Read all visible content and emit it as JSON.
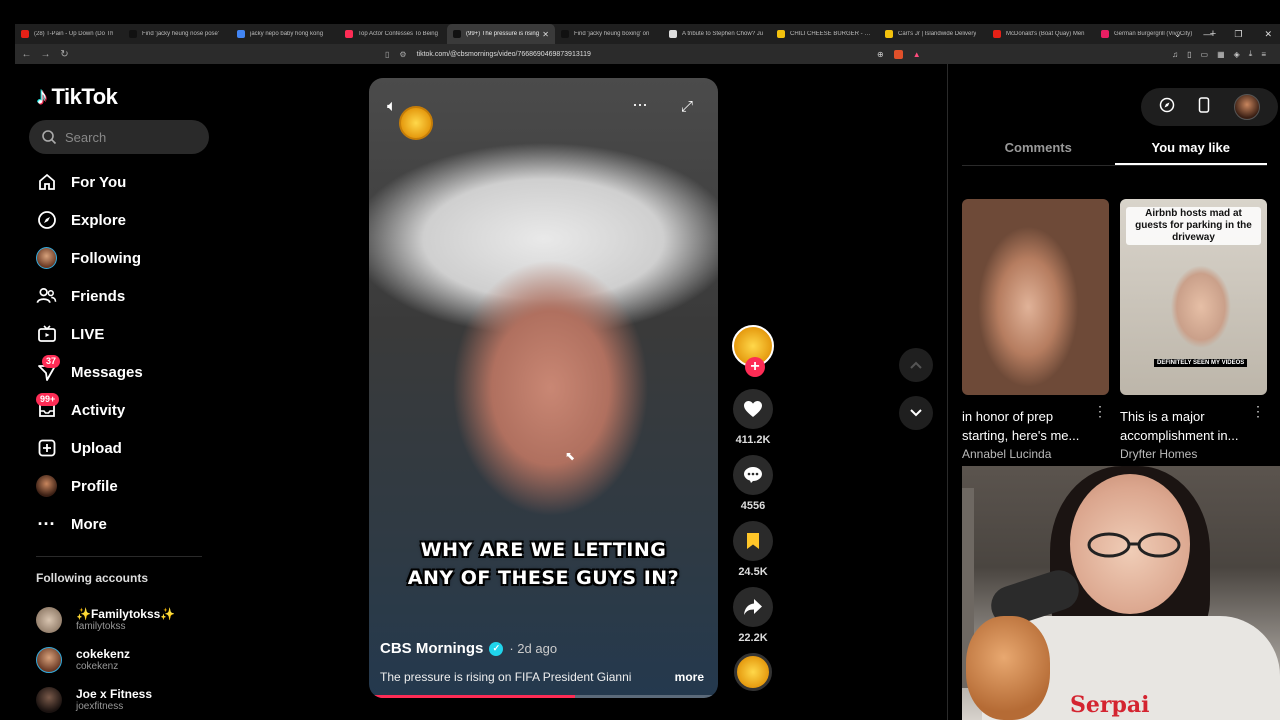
{
  "browser": {
    "tabs": [
      {
        "title": "(28) T-Pain - Up Down (Do Th",
        "color": "#e62117",
        "active": false
      },
      {
        "title": "Find 'jacky heung nose pose'",
        "color": "#111111",
        "active": false
      },
      {
        "title": "jacky nepo baby hong kong",
        "color": "#4285f4",
        "active": false
      },
      {
        "title": "Top Actor Confesses To Being",
        "color": "#fe2c55",
        "active": false
      },
      {
        "title": "(99+) The pressure is rising",
        "color": "#111111",
        "active": true
      },
      {
        "title": "Find 'jacky heung boxing' on",
        "color": "#111111",
        "active": false
      },
      {
        "title": "A tribute to Stephen Chow? Ju",
        "color": "#dddddd",
        "active": false
      },
      {
        "title": "CHILI CHEESE BURGER - Carl's",
        "color": "#f4c20d",
        "active": false
      },
      {
        "title": "Carl's Jr | Islandwide Delivery",
        "color": "#f4c20d",
        "active": false
      },
      {
        "title": "McDonald's (Boat Quay) Men",
        "color": "#e62117",
        "active": false
      },
      {
        "title": "German Burgergrill (VivoCity)",
        "color": "#e91e63",
        "active": false
      }
    ],
    "url": "tiktok.com/@cbsmornings/video/7668690469873913119"
  },
  "sidebar": {
    "brand": "TikTok",
    "search_placeholder": "Search",
    "nav": [
      {
        "label": "For You",
        "icon": "home-icon"
      },
      {
        "label": "Explore",
        "icon": "compass-icon"
      },
      {
        "label": "Following",
        "icon": "avatar"
      },
      {
        "label": "Friends",
        "icon": "friends-icon"
      },
      {
        "label": "LIVE",
        "icon": "live-icon"
      },
      {
        "label": "Messages",
        "icon": "paper-plane-icon",
        "badge": "37"
      },
      {
        "label": "Activity",
        "icon": "inbox-icon",
        "badge": "99+"
      },
      {
        "label": "Upload",
        "icon": "plus-square-icon"
      },
      {
        "label": "Profile",
        "icon": "avatar"
      },
      {
        "label": "More",
        "icon": "ellipsis-icon"
      }
    ],
    "following_title": "Following accounts",
    "following": [
      {
        "name": "✨Familytokss✨",
        "handle": "familytokss"
      },
      {
        "name": "cokekenz",
        "handle": "cokekenz"
      },
      {
        "name": "Joe x Fitness",
        "handle": "joexfitness"
      }
    ]
  },
  "video": {
    "caption_line1": "WHY ARE WE LETTING",
    "caption_line2": "ANY OF THESE GUYS IN?",
    "author": "CBS Mornings",
    "time_ago": "· 2d ago",
    "description": "The pressure is rising on FIFA President Gianni",
    "more_label": "more",
    "progress": 0.59
  },
  "actions": {
    "likes": "411.2K",
    "comments": "4556",
    "saves": "24.5K",
    "shares": "22.2K"
  },
  "right_panel": {
    "tabs": [
      {
        "label": "Comments",
        "active": false
      },
      {
        "label": "You may like",
        "active": true
      }
    ],
    "cards": [
      {
        "title": "in honor of prep starting, here's me...",
        "author": "Annabel Lucinda",
        "overlay": "",
        "sub": ""
      },
      {
        "title": "This is a major accomplishment in...",
        "author": "Dryfter Homes",
        "overlay": "Airbnb hosts mad at guests for parking in the driveway",
        "sub": "DEFINITELY SEEN MY VIDEOS"
      }
    ]
  },
  "webcam": {
    "shirt_text": "Serpai"
  }
}
